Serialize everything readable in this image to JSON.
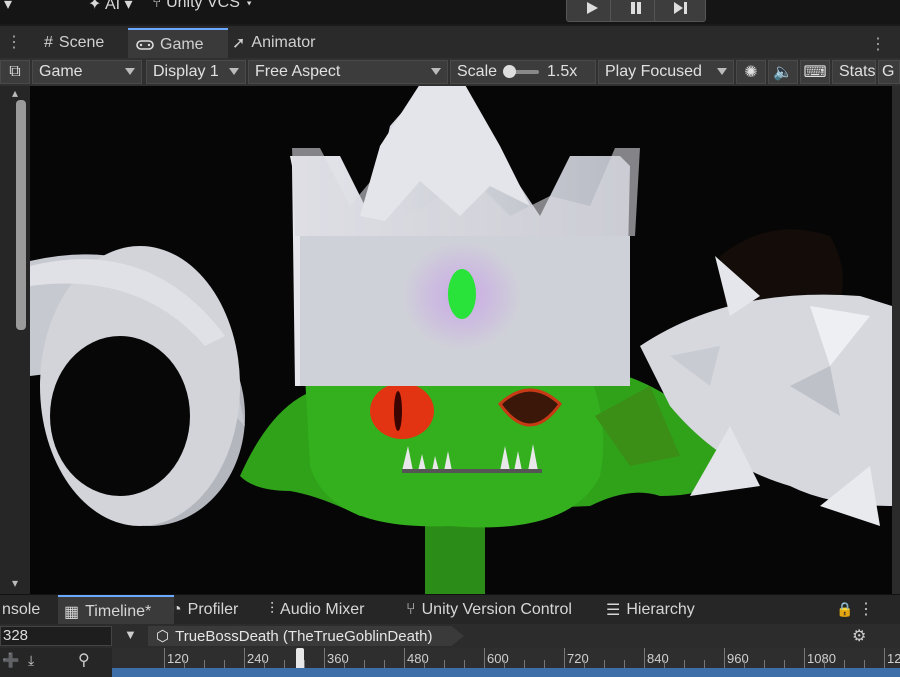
{
  "top": {
    "ai_label": "AI",
    "vcs_label": "Unity VCS"
  },
  "tabs": {
    "scene": "Scene",
    "game": "Game",
    "animator": "Animator"
  },
  "toolbar": {
    "view_mode": "Game",
    "display": "Display 1",
    "aspect": "Free Aspect",
    "scale_label": "Scale",
    "scale_value": "1.5x",
    "play_mode": "Play Focused",
    "stats": "Stats",
    "gizmos": "G"
  },
  "bottom_tabs": {
    "console": "nsole",
    "timeline": "Timeline*",
    "profiler": "Profiler",
    "audio_mixer": "Audio Mixer",
    "vcs": "Unity Version Control",
    "hierarchy": "Hierarchy"
  },
  "timeline": {
    "frame": "328",
    "breadcrumb": "TrueBossDeath (TheTrueGoblinDeath)",
    "ruler_labels": [
      "120",
      "240",
      "360",
      "480",
      "600",
      "720",
      "840",
      "960",
      "1080",
      "12"
    ]
  },
  "colors": {
    "accent": "#6aa9ff",
    "goblin_green": "#2fa21a",
    "crown_gray": "#c9ccd4",
    "gem_green": "#29e23a",
    "eye_red": "#e23412"
  }
}
